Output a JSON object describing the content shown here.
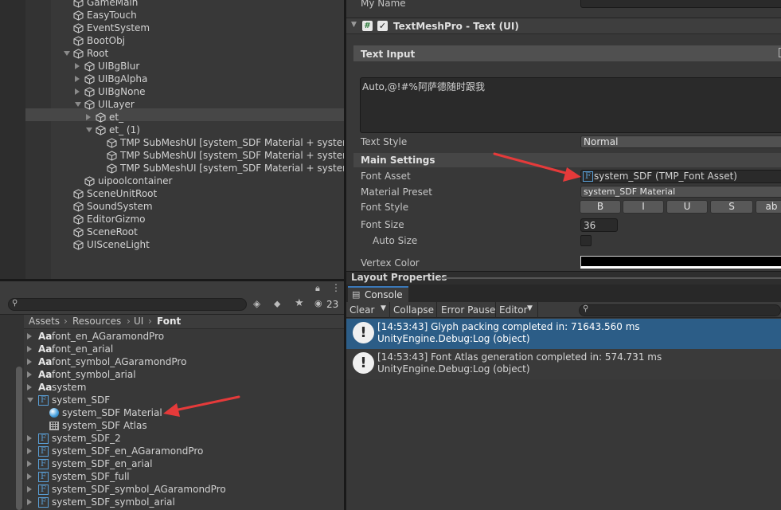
{
  "hierarchy": {
    "items": [
      {
        "label": "GameMain",
        "indent": 0
      },
      {
        "label": "EasyTouch",
        "indent": 0
      },
      {
        "label": "EventSystem",
        "indent": 0
      },
      {
        "label": "BootObj",
        "indent": 0
      },
      {
        "label": "Root",
        "indent": 0
      },
      {
        "label": "UIBgBlur",
        "indent": 1
      },
      {
        "label": "UIBgAlpha",
        "indent": 1
      },
      {
        "label": "UIBgNone",
        "indent": 1
      },
      {
        "label": "UILayer",
        "indent": 1
      },
      {
        "label": "et_",
        "indent": 2
      },
      {
        "label": "et_ (1)",
        "indent": 2
      },
      {
        "label": "TMP SubMeshUI [system_SDF Material + system_",
        "indent": 3
      },
      {
        "label": "TMP SubMeshUI [system_SDF Material + system_",
        "indent": 3
      },
      {
        "label": "TMP SubMeshUI [system_SDF Material + system_",
        "indent": 3
      },
      {
        "label": "uipoolcontainer",
        "indent": 1
      },
      {
        "label": "SceneUnitRoot",
        "indent": 0
      },
      {
        "label": "SoundSystem",
        "indent": 0
      },
      {
        "label": "EditorGizmo",
        "indent": 0
      },
      {
        "label": "SceneRoot",
        "indent": 0
      },
      {
        "label": "UISceneLight",
        "indent": 0
      }
    ]
  },
  "project": {
    "search_placeholder": "",
    "hidden_count": "23",
    "breadcrumb": [
      "Assets",
      "Resources",
      "UI",
      "Font"
    ],
    "files": [
      {
        "label": "font_en_AGaramondPro",
        "type": "aa"
      },
      {
        "label": "font_en_arial",
        "type": "aa"
      },
      {
        "label": "font_symbol_AGaramondPro",
        "type": "aa"
      },
      {
        "label": "font_symbol_arial",
        "type": "aa"
      },
      {
        "label": "system",
        "type": "aa"
      },
      {
        "label": "system_SDF",
        "type": "F"
      },
      {
        "label": "system_SDF Material",
        "type": "material"
      },
      {
        "label": "system_SDF Atlas",
        "type": "atlas"
      },
      {
        "label": "system_SDF_2",
        "type": "F"
      },
      {
        "label": "system_SDF_en_AGaramondPro",
        "type": "F"
      },
      {
        "label": "system_SDF_en_arial",
        "type": "F"
      },
      {
        "label": "system_SDF_full",
        "type": "F"
      },
      {
        "label": "system_SDF_symbol_AGaramondPro",
        "type": "F"
      },
      {
        "label": "system_SDF_symbol_arial",
        "type": "F"
      }
    ]
  },
  "inspector": {
    "my_name_label": "My Name",
    "component_title": "TextMeshPro - Text (UI)",
    "text_input_header": "Text Input",
    "text_input_value": "Auto,@!#%阿萨德随时跟我",
    "text_style_label": "Text Style",
    "text_style_value": "Normal",
    "main_settings_header": "Main Settings",
    "font_asset_label": "Font Asset",
    "font_asset_value": "system_SDF (TMP_Font Asset)",
    "material_preset_label": "Material Preset",
    "material_preset_value": "system_SDF Material",
    "font_style_label": "Font Style",
    "font_style_buttons": [
      "B",
      "I",
      "U",
      "S",
      "ab"
    ],
    "font_size_label": "Font Size",
    "font_size_value": "36",
    "auto_size_label": "Auto Size",
    "vertex_color_label": "Vertex Color",
    "layout_properties_label": "Layout Properties"
  },
  "console": {
    "tab_label": "Console",
    "clear_label": "Clear",
    "collapse_label": "Collapse",
    "error_pause_label": "Error Pause",
    "editor_label": "Editor",
    "search_placeholder": "",
    "logs": [
      {
        "line1": "[14:53:43] Glyph packing completed in: 71643.560 ms",
        "line2": "UnityEngine.Debug:Log (object)",
        "selected": true
      },
      {
        "line1": "[14:53:43] Font Atlas generation completed in: 574.731 ms",
        "line2": "UnityEngine.Debug:Log (object)",
        "selected": false
      }
    ]
  },
  "colors": {
    "selection": "#2c5d87",
    "panel": "#383838",
    "arrow": "#e53a3a"
  }
}
